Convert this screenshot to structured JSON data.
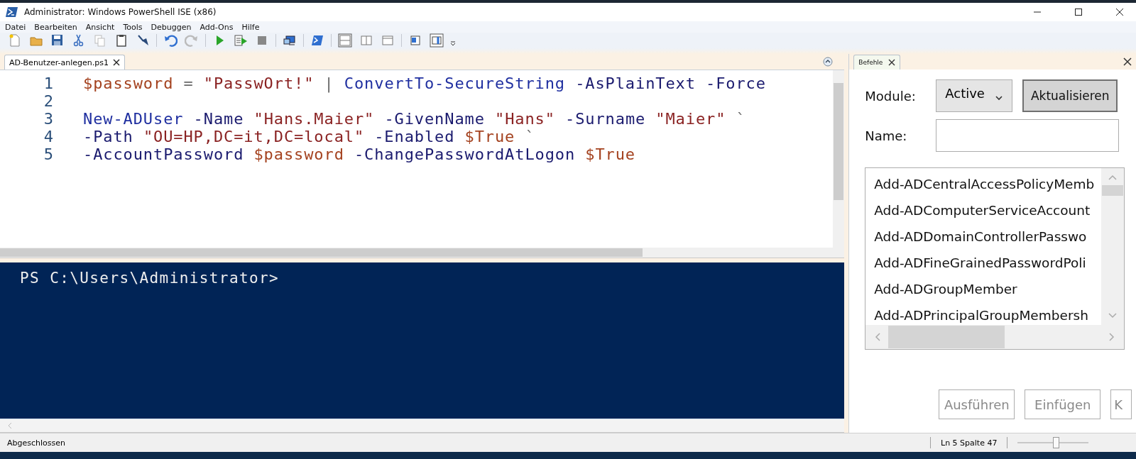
{
  "window": {
    "title": "Administrator: Windows PowerShell ISE (x86)"
  },
  "menu": [
    "Datei",
    "Bearbeiten",
    "Ansicht",
    "Tools",
    "Debuggen",
    "Add-Ons",
    "Hilfe"
  ],
  "editor_tabs": [
    {
      "label": "AD-Benutzer-anlegen.ps1",
      "selected": true
    }
  ],
  "script_lines": [
    {
      "number": "1",
      "tokens": [
        {
          "kind": "variable",
          "text": "$password "
        },
        {
          "kind": "operator",
          "text": "= "
        },
        {
          "kind": "string",
          "text": "\"PasswOrt!\" "
        },
        {
          "kind": "operator",
          "text": "| "
        },
        {
          "kind": "command",
          "text": "ConvertTo-SecureString "
        },
        {
          "kind": "parameter",
          "text": "-AsPlainText "
        },
        {
          "kind": "parameter",
          "text": "-Force"
        }
      ]
    },
    {
      "number": "2"
    },
    {
      "number": "3",
      "tokens": [
        {
          "kind": "command",
          "text": "New-ADUser "
        },
        {
          "kind": "parameter",
          "text": "-Name "
        },
        {
          "kind": "string",
          "text": "\"Hans.Maier\" "
        },
        {
          "kind": "parameter",
          "text": "-GivenName "
        },
        {
          "kind": "string",
          "text": "\"Hans\" "
        },
        {
          "kind": "parameter",
          "text": "-Surname "
        },
        {
          "kind": "string",
          "text": "\"Maier\" "
        },
        {
          "kind": "operator",
          "text": "`"
        }
      ]
    },
    {
      "number": "4",
      "tokens": [
        {
          "kind": "parameter",
          "text": "-Path "
        },
        {
          "kind": "string",
          "text": "\"OU=HP,DC=it,DC=local\" "
        },
        {
          "kind": "parameter",
          "text": "-Enabled "
        },
        {
          "kind": "variable",
          "text": "$True "
        },
        {
          "kind": "operator",
          "text": "`"
        }
      ]
    },
    {
      "number": "5",
      "tokens": [
        {
          "kind": "parameter",
          "text": "-AccountPassword "
        },
        {
          "kind": "variable",
          "text": "$password "
        },
        {
          "kind": "parameter",
          "text": "-ChangePasswordAtLogon "
        },
        {
          "kind": "variable",
          "text": "$True"
        }
      ]
    }
  ],
  "console": {
    "prompt": "PS C:\\Users\\Administrator>"
  },
  "commands_pane": {
    "tab": {
      "label": "Befehle",
      "selected": true
    },
    "module_label": "Module:",
    "module_value": "Active",
    "refresh_button": "Aktualisieren",
    "name_label": "Name:",
    "commands": [
      "Add-ADCentralAccessPolicyMemb",
      "Add-ADComputerServiceAccount",
      "Add-ADDomainControllerPasswo",
      "Add-ADFineGrainedPasswordPoli",
      "Add-ADGroupMember",
      "Add-ADPrincipalGroupMembersh"
    ],
    "buttons": [
      {
        "label": "Ausführen",
        "disabled": true
      },
      {
        "label": "Einfügen",
        "disabled": true
      },
      {
        "label": "K",
        "disabled": true
      }
    ]
  },
  "status_bar": {
    "status": "Abgeschlossen",
    "position": "Ln 5  Spalte 47",
    "zoom": {
      "level": 0.55
    }
  }
}
